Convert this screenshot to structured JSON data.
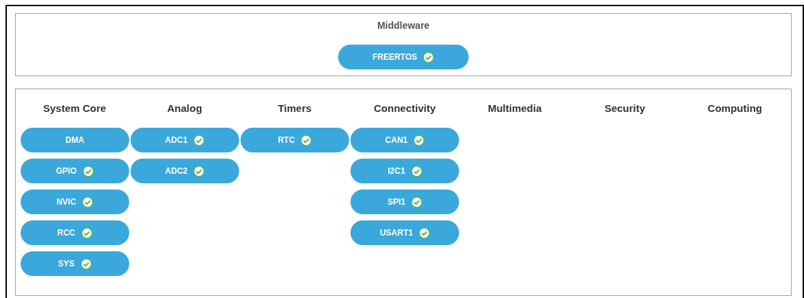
{
  "middleware": {
    "title": "Middleware",
    "items": [
      {
        "label": "FREERTOS",
        "checked": true
      }
    ]
  },
  "categories": [
    {
      "title": "System Core",
      "items": [
        {
          "label": "DMA",
          "checked": false
        },
        {
          "label": "GPIO",
          "checked": true
        },
        {
          "label": "NVIC",
          "checked": true
        },
        {
          "label": "RCC",
          "checked": true
        },
        {
          "label": "SYS",
          "checked": true
        }
      ]
    },
    {
      "title": "Analog",
      "items": [
        {
          "label": "ADC1",
          "checked": true
        },
        {
          "label": "ADC2",
          "checked": true
        }
      ]
    },
    {
      "title": "Timers",
      "items": [
        {
          "label": "RTC",
          "checked": true
        }
      ]
    },
    {
      "title": "Connectivity",
      "items": [
        {
          "label": "CAN1",
          "checked": true
        },
        {
          "label": "I2C1",
          "checked": true
        },
        {
          "label": "SPI1",
          "checked": true
        },
        {
          "label": "USART1",
          "checked": true
        }
      ]
    },
    {
      "title": "Multimedia"
    },
    {
      "title": "Security"
    },
    {
      "title": "Computing"
    }
  ]
}
